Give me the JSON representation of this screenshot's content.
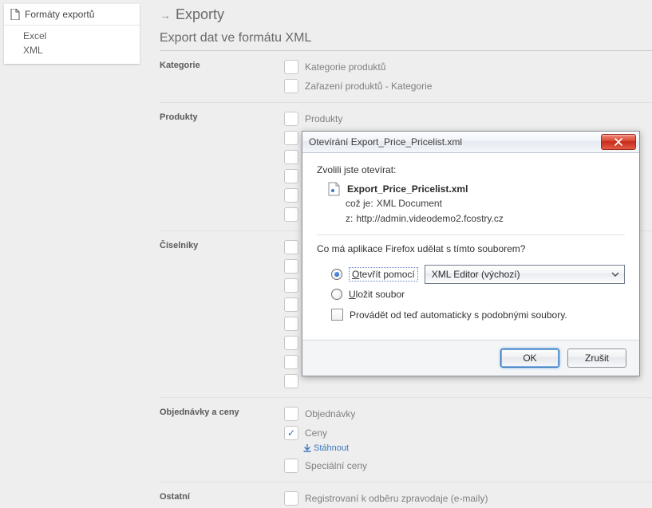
{
  "sidebar": {
    "title": "Formáty exportů",
    "items": [
      {
        "label": "Excel"
      },
      {
        "label": "XML"
      }
    ]
  },
  "page": {
    "title": "Exporty",
    "subtitle": "Export dat ve formátu XML"
  },
  "sections": {
    "kategorie": {
      "label": "Kategorie",
      "items": [
        {
          "label": "Kategorie produktů",
          "checked": false
        },
        {
          "label": "Zařazení produktů - Kategorie",
          "checked": false
        }
      ]
    },
    "produkty": {
      "label": "Produkty",
      "items": [
        {
          "label": "Produkty",
          "checked": false
        },
        {
          "label": "",
          "checked": false
        },
        {
          "label": "",
          "checked": false
        },
        {
          "label": "",
          "checked": false
        },
        {
          "label": "",
          "checked": false
        },
        {
          "label": "",
          "checked": false
        }
      ]
    },
    "ciselniky": {
      "label": "Číselníky",
      "items": [
        {
          "label": "",
          "checked": false
        },
        {
          "label": "",
          "checked": false
        },
        {
          "label": "",
          "checked": false
        },
        {
          "label": "",
          "checked": false
        },
        {
          "label": "",
          "checked": false
        },
        {
          "label": "",
          "checked": false
        },
        {
          "label": "",
          "checked": false
        },
        {
          "label": "",
          "checked": false
        }
      ]
    },
    "objednavky": {
      "label": "Objednávky a ceny",
      "items": [
        {
          "label": "Objednávky",
          "checked": false
        },
        {
          "label": "Ceny",
          "checked": true,
          "download": "Stáhnout"
        },
        {
          "label": "Speciální ceny",
          "checked": false
        }
      ]
    },
    "ostatni": {
      "label": "Ostatní",
      "items": [
        {
          "label": "Registrovaní k odběru zpravodaje (e-maily)",
          "checked": false
        }
      ]
    }
  },
  "dialog": {
    "title": "Otevírání Export_Price_Pricelist.xml",
    "lead": "Zvolili jste otevírat:",
    "filename": "Export_Price_Pricelist.xml",
    "type_label": "což je:",
    "type_value": "XML Document",
    "from_label": "z:",
    "from_value": "http://admin.videodemo2.fcostry.cz",
    "question": "Co má aplikace Firefox udělat s tímto souborem?",
    "open_with": "Otevřít pomocí",
    "open_with_u": "O",
    "app_selected": "XML Editor (výchozí)",
    "save": "Uložit soubor",
    "save_u": "U",
    "auto": "Provádět od teď automaticky s podobnými soubory.",
    "auto_u": "a",
    "ok": "OK",
    "cancel": "Zrušit"
  }
}
